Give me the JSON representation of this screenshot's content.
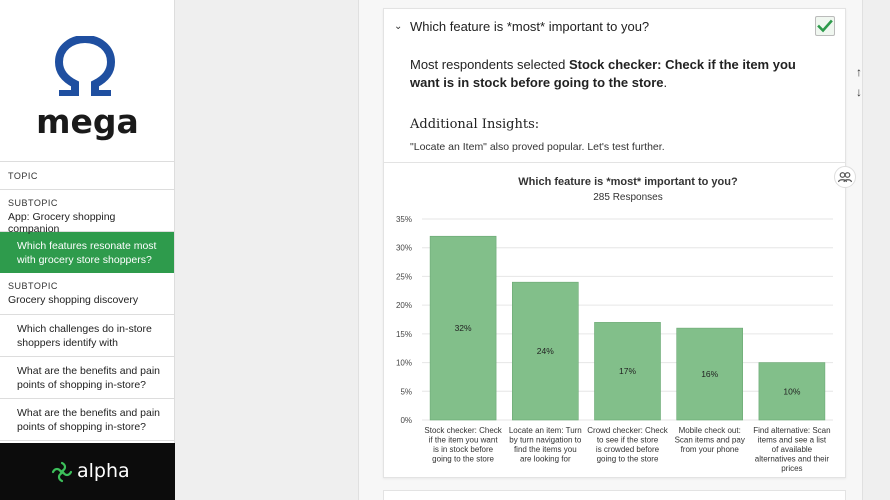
{
  "brand": {
    "logo_text": "mega",
    "footer_logo_text": "alpha"
  },
  "sidebar": {
    "topic_caption": "TOPIC",
    "subtopic1": {
      "caption": "SUBTOPIC",
      "value": "App: Grocery shopping companion"
    },
    "active_question": "Which features resonate most with grocery store shoppers?",
    "subtopic2": {
      "caption": "SUBTOPIC",
      "value": "Grocery shopping discovery"
    },
    "questions": [
      "Which challenges do in-store shoppers identify with",
      "What are the benefits and pain points of shopping in-store?",
      "What are the benefits and pain points of shopping in-store?"
    ]
  },
  "question": {
    "title": "Which feature is *most* important to you?",
    "summary_prefix": "Most respondents selected ",
    "summary_bold": "Stock checker: Check if the item you want is in stock before going to the store",
    "summary_suffix": ".",
    "insights_title": "Additional Insights:",
    "insights_text": "\"Locate an Item\" also proved popular. Let's test further."
  },
  "colors": {
    "bar": "#82bf8a",
    "bar_stroke": "#6aa873",
    "active_nav": "#2e9b4c",
    "check": "#2e9b4c"
  },
  "chart_data": {
    "type": "bar",
    "title": "Which feature is *most* important to you?",
    "subtitle": "285 Responses",
    "categories": [
      [
        "Stock checker: Check",
        "if the item you want",
        "is in stock before",
        "going to the store"
      ],
      [
        "Locate an item: Turn",
        "by turn navigation to",
        "find the items you",
        "are looking for"
      ],
      [
        "Crowd checker: Check",
        "to see if the store",
        "is crowded before",
        "going to the store"
      ],
      [
        "Mobile check out:",
        "Scan items and pay",
        "from your phone"
      ],
      [
        "Find alternative: Scan",
        "items and see a list",
        "of available",
        "alternatives and their",
        "prices"
      ]
    ],
    "values": [
      32,
      24,
      17,
      16,
      10
    ],
    "value_labels": [
      "32%",
      "24%",
      "17%",
      "16%",
      "10%"
    ],
    "yticks": [
      "0%",
      "5%",
      "10%",
      "15%",
      "20%",
      "25%",
      "30%",
      "35%"
    ],
    "ylim": [
      0,
      35
    ],
    "grid": true
  }
}
